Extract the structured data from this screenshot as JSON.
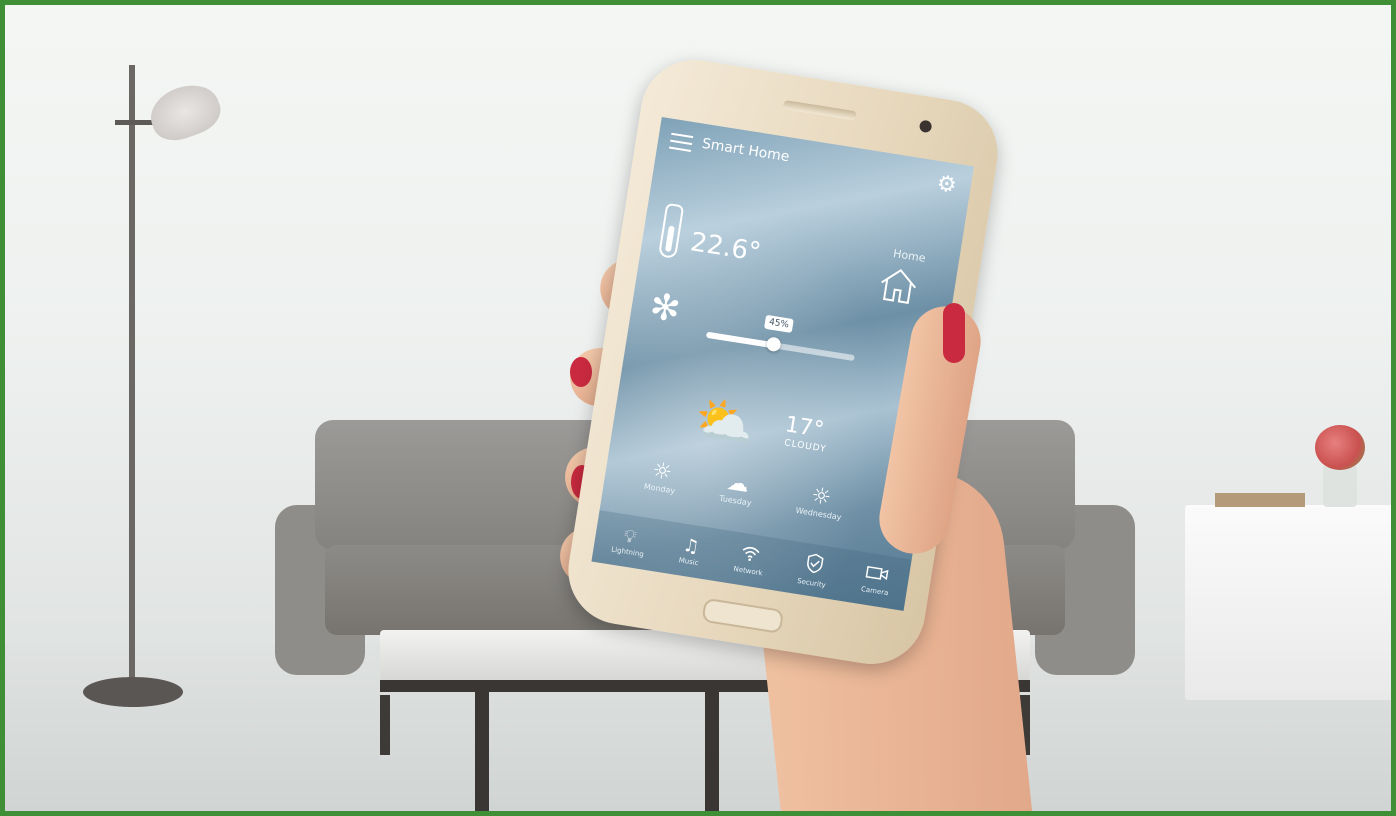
{
  "app": {
    "title": "Smart Home",
    "home_label": "Home",
    "indoor_temperature": "22.6°",
    "fan_level_label": "45%",
    "fan_level": 0.45,
    "outdoor_temperature": "17°",
    "condition": "CLOUDY"
  },
  "forecast": [
    {
      "day": "Monday",
      "icon": "sun-icon"
    },
    {
      "day": "Tuesday",
      "icon": "rain-cloud-icon"
    },
    {
      "day": "Wednesday",
      "icon": "sun-icon"
    }
  ],
  "bottom_nav": [
    {
      "label": "Lightning",
      "icon": "lightbulb-icon"
    },
    {
      "label": "Music",
      "icon": "music-note-icon"
    },
    {
      "label": "Network",
      "icon": "wifi-icon"
    },
    {
      "label": "Security",
      "icon": "shield-check-icon"
    },
    {
      "label": "Camera",
      "icon": "video-camera-icon"
    }
  ],
  "colors": {
    "frame_border": "#3f8f37",
    "nail_polish": "#c92a3f",
    "phone_body": "#e7d8bd"
  }
}
